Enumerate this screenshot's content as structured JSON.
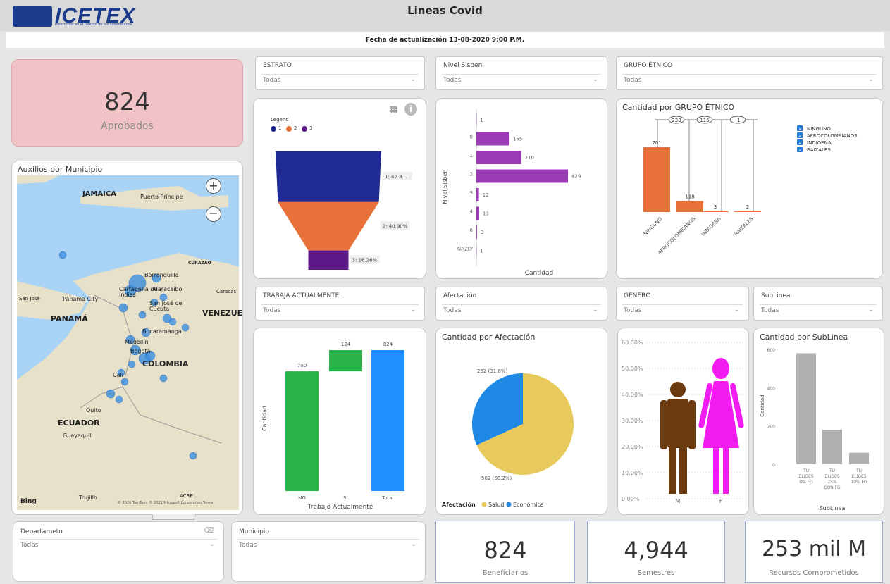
{
  "header": {
    "title": "Lineas Covid",
    "logo_text": "ICETEX",
    "logo_tagline": "Invertimos en el talento de los colombianos",
    "update_text": "Fecha de actualización 13-08-2020 9:00 P.M."
  },
  "kpis": {
    "aprobados": {
      "value": "824",
      "label": "Aprobados"
    },
    "beneficiarios": {
      "value": "824",
      "label": "Beneficiarios"
    },
    "semestres": {
      "value": "4,944",
      "label": "Semestres"
    },
    "recursos": {
      "value": "253 mil M",
      "label": "Recursos Comprometidos"
    }
  },
  "slicers": {
    "estrato": {
      "title": "ESTRATO",
      "value": "Todas"
    },
    "nivel_sisben": {
      "title": "Nivel Sisben",
      "value": "Todas"
    },
    "grupo_etnico": {
      "title": "GRUPO ÉTNICO",
      "value": "Todas"
    },
    "trabaja": {
      "title": "TRABAJA ACTUALMENTE",
      "value": "Todas"
    },
    "afectacion": {
      "title": "Afectación",
      "value": "Todas"
    },
    "genero": {
      "title": "GENERO",
      "value": "Todas"
    },
    "sublinea": {
      "title": "SubLinea",
      "value": "Todas"
    },
    "departamento": {
      "title": "Departameto",
      "value": "Todas"
    },
    "municipio": {
      "title": "Municipio",
      "value": "Todas"
    }
  },
  "map": {
    "title": "Auxilios por Municipio",
    "labels": [
      "JAMAICA",
      "Puerto Príncipe",
      "CURAZAO",
      "Barranquilla",
      "Cartagena de Indias",
      "Maracaibo",
      "Caracas",
      "San José",
      "Panama City",
      "San José de Cúcuta",
      "PANAMÁ",
      "VENEZUE",
      "Bucaramanga",
      "Medellín",
      "Bogotá",
      "COLOMBIA",
      "Cali",
      "Quito",
      "ECUADOR",
      "Guayaquil",
      "Trujillo",
      "ACRE"
    ],
    "attribution": "© 2020 TomTom, © 2021 Microsoft Corporation  Terms",
    "bing_label": "Bing"
  },
  "funnel": {
    "legend_title": "Legend",
    "legend": [
      "1",
      "2",
      "3"
    ],
    "colors": [
      "#1f2a94",
      "#e8713a",
      "#5c1787"
    ],
    "values": [
      42.8,
      40.9,
      16.26
    ],
    "labels": [
      "1: 42.8...",
      "2: 40.90%",
      "3: 16.26%"
    ]
  },
  "sisben_chart": {
    "ylabel": "Nivel Sisben",
    "xlabel": "Cantidad",
    "categories": [
      "",
      "0",
      "1",
      "2",
      "3",
      "4",
      "6",
      "NAZLY"
    ],
    "values": [
      1,
      155,
      210,
      429,
      12,
      13,
      3,
      1
    ],
    "color": "#9b3ab5"
  },
  "etnico_chart": {
    "title": "Cantidad por GRUPO ÉTNICO",
    "categories": [
      "NINGUNO",
      "AFROCOLOMBIANOS",
      "INDIGENA",
      "RAIZALES"
    ],
    "values": [
      701,
      118,
      3,
      2
    ],
    "bubbles": [
      "233",
      "115",
      "-1"
    ],
    "legend": [
      "NINGUNO",
      "AFROCOLOMBIANOS",
      "INDIGENA",
      "RAIZALES"
    ],
    "color": "#e8713a"
  },
  "trabaja_chart": {
    "ylabel": "Cantidad",
    "xlabel": "Trabajo Actualmente",
    "categories": [
      "NO",
      "SI",
      "Total"
    ],
    "values": [
      700,
      124,
      824
    ],
    "labels": [
      "700",
      "124",
      "824"
    ],
    "colors": [
      "#28b44b",
      "#28b44b",
      "#1e90ff"
    ]
  },
  "afectacion_chart": {
    "title": "Cantidad por Afectación",
    "slices": [
      {
        "name": "Salud",
        "value": 562,
        "label": "562 (68.2%)",
        "color": "#e8c95c"
      },
      {
        "name": "Económica",
        "value": 262,
        "label": "262 (31.8%)",
        "color": "#1e88e5"
      }
    ],
    "legend_title": "Afectación"
  },
  "genero_chart": {
    "ticks": [
      "60.00%",
      "50.00%",
      "40.00%",
      "30.00%",
      "20.00%",
      "10.00%",
      "0.00%"
    ],
    "categories": [
      "M",
      "F"
    ],
    "colors": [
      "#6b3a0e",
      "#f21cf2"
    ]
  },
  "sublinea_chart": {
    "title": "Cantidad por SubLinea",
    "ylabel": "Cantidad",
    "xlabel": "SubLinea",
    "yticks": [
      "600",
      "400",
      "200",
      "0"
    ],
    "categories": [
      "TU ELIGES 0% FG",
      "TU ELIGES 25% CON FG",
      "TU ELIGES 10% FG"
    ],
    "values": [
      580,
      180,
      60
    ],
    "color": "#b0b0b0"
  }
}
